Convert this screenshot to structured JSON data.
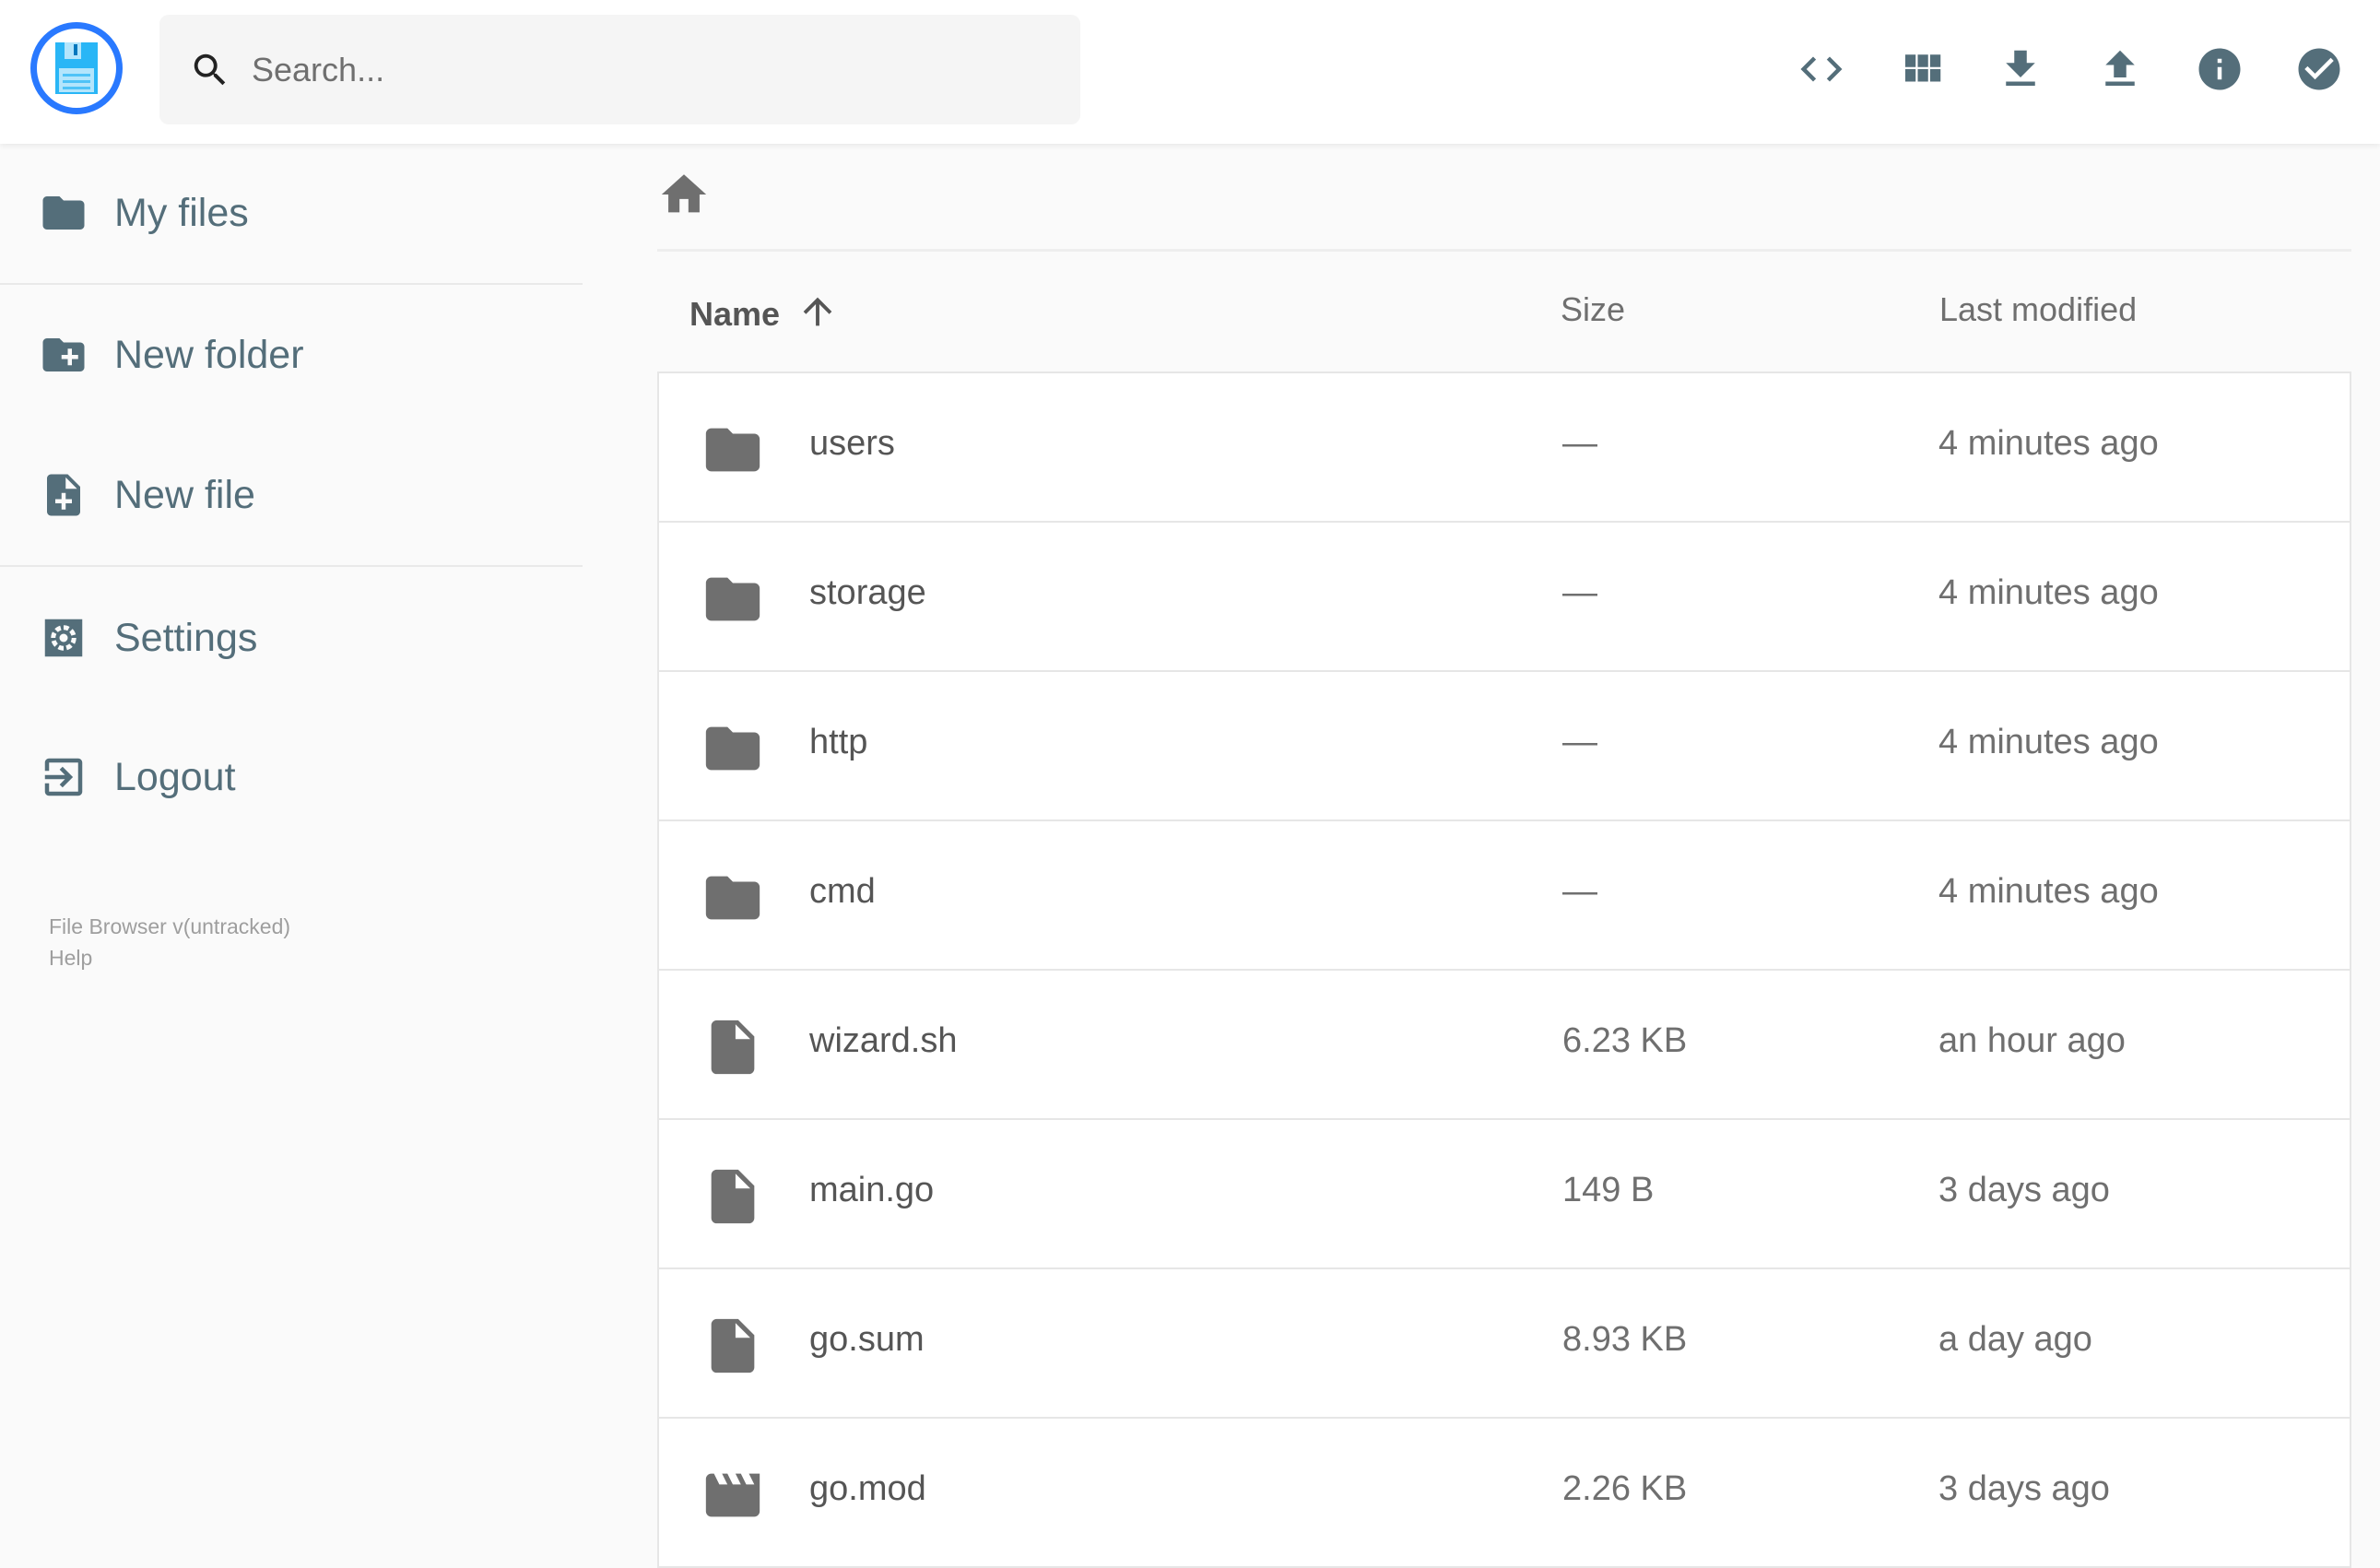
{
  "header": {
    "search_placeholder": "Search...",
    "actions": [
      "code-icon",
      "grid-view-icon",
      "download-icon",
      "upload-icon",
      "info-icon",
      "check-circle-icon"
    ]
  },
  "sidebar": {
    "items": [
      {
        "label": "My files",
        "icon": "folder-icon"
      },
      {
        "label": "New folder",
        "icon": "create-folder-icon"
      },
      {
        "label": "New file",
        "icon": "note-add-icon"
      },
      {
        "label": "Settings",
        "icon": "settings-icon"
      },
      {
        "label": "Logout",
        "icon": "logout-icon"
      }
    ],
    "footer": {
      "version": "File Browser v(untracked)",
      "help": "Help"
    }
  },
  "listing": {
    "columns": {
      "name": "Name",
      "size": "Size",
      "modified": "Last modified"
    },
    "sort": "name-ascending",
    "rows": [
      {
        "name": "users",
        "type": "folder",
        "size": "—",
        "modified": "4 minutes ago"
      },
      {
        "name": "storage",
        "type": "folder",
        "size": "—",
        "modified": "4 minutes ago"
      },
      {
        "name": "http",
        "type": "folder",
        "size": "—",
        "modified": "4 minutes ago"
      },
      {
        "name": "cmd",
        "type": "folder",
        "size": "—",
        "modified": "4 minutes ago"
      },
      {
        "name": "wizard.sh",
        "type": "file",
        "size": "6.23 KB",
        "modified": "an hour ago"
      },
      {
        "name": "main.go",
        "type": "file",
        "size": "149 B",
        "modified": "3 days ago"
      },
      {
        "name": "go.sum",
        "type": "file",
        "size": "8.93 KB",
        "modified": "a day ago"
      },
      {
        "name": "go.mod",
        "type": "video",
        "size": "2.26 KB",
        "modified": "3 days ago"
      }
    ]
  },
  "colors": {
    "accent": "#2979ff",
    "sidebar_text": "#546e7a",
    "icon_gray": "#6f6f6f"
  }
}
